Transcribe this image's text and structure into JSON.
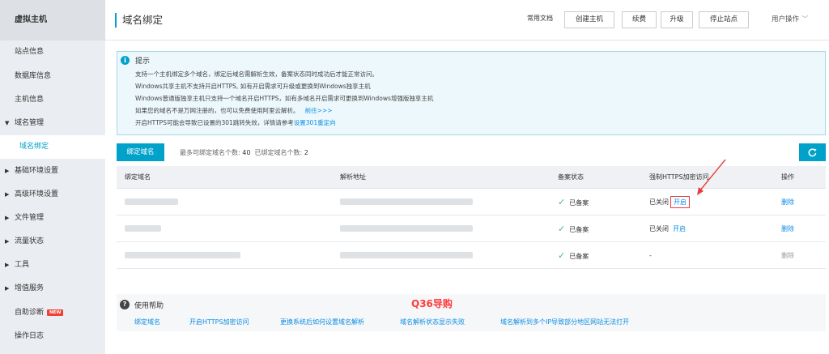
{
  "sidebar": {
    "title": "虚拟主机",
    "items": [
      {
        "label": "站点信息"
      },
      {
        "label": "数据库信息"
      },
      {
        "label": "主机信息"
      },
      {
        "label": "域名管理"
      },
      {
        "label": "域名绑定"
      },
      {
        "label": "基础环境设置"
      },
      {
        "label": "高级环境设置"
      },
      {
        "label": "文件管理"
      },
      {
        "label": "流量状态"
      },
      {
        "label": "工具"
      },
      {
        "label": "增值服务"
      },
      {
        "label": "自助诊断",
        "badge": "NEW"
      },
      {
        "label": "操作日志"
      }
    ]
  },
  "header": {
    "title": "域名绑定",
    "doc_link": "常用文档",
    "buttons": [
      "创建主机",
      "续费",
      "升级",
      "停止站点"
    ],
    "user_menu": "用户操作"
  },
  "tips": {
    "title": "提示",
    "lines": [
      "支持一个主机绑定多个域名，绑定后域名需解析生效，备案状态同时成功后才能正常访问。",
      "Windows共享主机不支持开启HTTPS, 如有开启需求可升级或更换到Windows独享主机",
      "Windows普通版独享主机只支持一个域名开启HTTPS，如有多域名开启需求可更换到Windows增强版独享主机",
      "如果您的域名不是万网注册的，也可以免费使用阿里云解析。"
    ],
    "line4_link": "前往>>>",
    "line5_text": "开启HTTPS可能会导致已设置的301跳转失效，详情请参考",
    "line5_link": "设置301重定向"
  },
  "toolbar": {
    "bind_button": "绑定域名",
    "max_label": "最多可绑定域名个数:",
    "max_value": "40",
    "bound_label": "已绑定域名个数:",
    "bound_value": "2"
  },
  "table": {
    "headers": [
      "绑定域名",
      "解析地址",
      "备案状态",
      "强制HTTPS加密访问",
      "操作"
    ],
    "rows": [
      {
        "status": "已备案",
        "https_state": "已关闭",
        "https_action": "开启",
        "op": "删除"
      },
      {
        "status": "已备案",
        "https_state": "已关闭",
        "https_action": "开启",
        "op": "删除"
      },
      {
        "status": "已备案",
        "https_state": "-",
        "https_action": "",
        "op": "删除"
      }
    ]
  },
  "help": {
    "title": "使用帮助",
    "links": [
      "绑定域名",
      "开启HTTPS加密访问",
      "更换系统后如何设置域名解析",
      "域名解析状态显示失败",
      "域名解析到多个IP导致部分地区网站无法打开"
    ]
  },
  "watermark": "Q36导购",
  "colors": {
    "accent": "#00a2ca",
    "link": "#0b8ee5",
    "success": "#3dbd7d",
    "highlight": "#e63e3e"
  }
}
